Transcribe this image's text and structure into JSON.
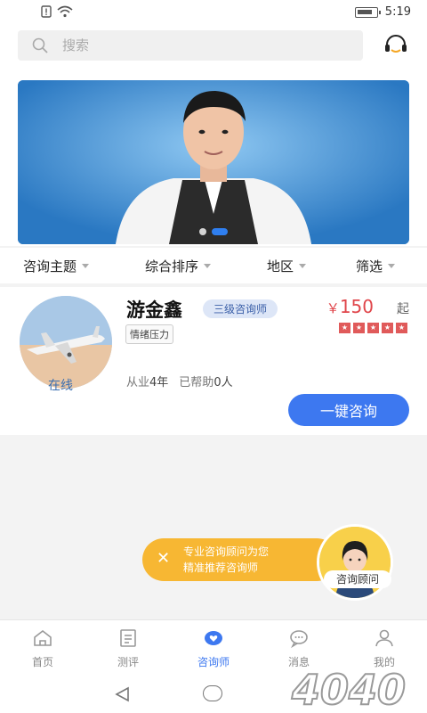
{
  "status_bar": {
    "time": "5:19"
  },
  "search": {
    "placeholder": "搜索"
  },
  "filters": [
    {
      "label": "咨询主题"
    },
    {
      "label": "综合排序"
    },
    {
      "label": "地区"
    },
    {
      "label": "筛选"
    }
  ],
  "counselor": {
    "name": "游金鑫",
    "level": "三级咨询师",
    "tag": "情绪压力",
    "status": "在线",
    "price_symbol": "￥",
    "price": "150",
    "price_suffix": "起",
    "stars": 5,
    "experience_label": "从业",
    "experience_value": "4年",
    "helped_label": "已帮助",
    "helped_value": "0人",
    "consult_button": "一键咨询"
  },
  "promo": {
    "line1": "专业咨询顾问为您",
    "line2": "精准推荐咨询师",
    "avatar_label": "咨询顾问"
  },
  "tabs": [
    {
      "label": "首页",
      "icon": "home-icon"
    },
    {
      "label": "测评",
      "icon": "assessment-icon"
    },
    {
      "label": "咨询师",
      "icon": "heart-chat-icon",
      "active": true
    },
    {
      "label": "消息",
      "icon": "message-icon"
    },
    {
      "label": "我的",
      "icon": "user-icon"
    }
  ],
  "watermark": {
    "text": "4040"
  },
  "colors": {
    "accent": "#3d78f0",
    "price": "#e0464b",
    "promo": "#f7b733",
    "badge_bg": "#dde6f7"
  }
}
